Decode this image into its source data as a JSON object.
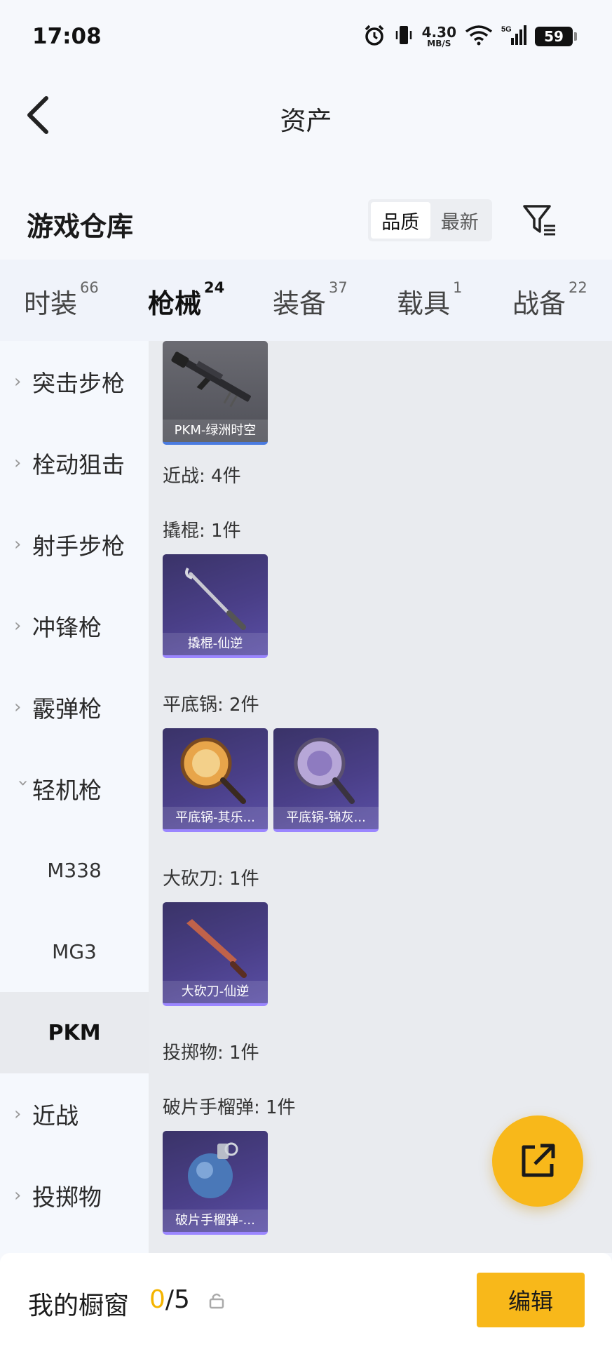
{
  "status_bar": {
    "time": "17:08",
    "speed_value": "4.30",
    "speed_unit": "MB/S",
    "network": "5G",
    "battery": "59"
  },
  "header": {
    "title": "资产"
  },
  "warehouse": {
    "title": "游戏仓库",
    "sort_options": [
      "品质",
      "最新"
    ],
    "active_sort": "品质"
  },
  "tabs": [
    {
      "label": "时装",
      "count": "66"
    },
    {
      "label": "枪械",
      "count": "24"
    },
    {
      "label": "装备",
      "count": "37"
    },
    {
      "label": "载具",
      "count": "1"
    },
    {
      "label": "战备",
      "count": "22"
    }
  ],
  "active_tab": "枪械",
  "sidebar": {
    "items": [
      {
        "label": "突击步枪"
      },
      {
        "label": "栓动狙击"
      },
      {
        "label": "射手步枪"
      },
      {
        "label": "冲锋枪"
      },
      {
        "label": "霰弹枪"
      },
      {
        "label": "轻机枪"
      },
      {
        "label": "M338"
      },
      {
        "label": "MG3"
      },
      {
        "label": "PKM"
      },
      {
        "label": "近战"
      },
      {
        "label": "投掷物"
      }
    ],
    "selected": "PKM"
  },
  "content": {
    "pkm_card": "PKM-绿洲时空",
    "sections": [
      {
        "label": "近战: 4件"
      },
      {
        "label": "撬棍: 1件"
      },
      {
        "label": "平底锅: 2件"
      },
      {
        "label": "大砍刀: 1件"
      },
      {
        "label": "投掷物: 1件"
      },
      {
        "label": "破片手榴弹: 1件"
      }
    ],
    "cards": {
      "crowbar": "撬棍-仙逆",
      "pan1": "平底锅-其乐...",
      "pan2": "平底锅-锦灰...",
      "machete": "大砍刀-仙逆",
      "grenade": "破片手榴弹-..."
    }
  },
  "bottom_bar": {
    "label": "我的橱窗",
    "current": "0",
    "total": "/5",
    "edit": "编辑"
  },
  "colors": {
    "accent": "#f8b81a",
    "tab_underline": "#f4b400",
    "card_purple": "#4a3f88"
  }
}
